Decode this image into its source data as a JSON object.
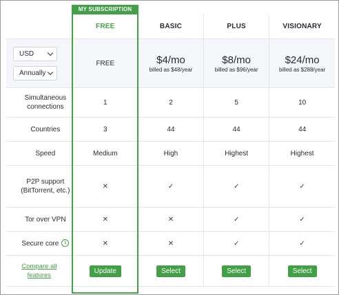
{
  "current_plan_tag": "MY SUBSCRIPTION",
  "plans": [
    {
      "name": "FREE",
      "price_main": "FREE",
      "price_billed": "",
      "button": "Update"
    },
    {
      "name": "BASIC",
      "price_main": "$4/mo",
      "price_billed": "billed as $48/year",
      "button": "Select"
    },
    {
      "name": "PLUS",
      "price_main": "$8/mo",
      "price_billed": "billed as $96/year",
      "button": "Select"
    },
    {
      "name": "VISIONARY",
      "price_main": "$24/mo",
      "price_billed": "billed as $288/year",
      "button": "Select"
    }
  ],
  "currency": {
    "selected": "USD"
  },
  "billing_cycle": {
    "selected": "Annually"
  },
  "features": {
    "simultaneous": {
      "label": "Simultaneous connections",
      "values": [
        "1",
        "2",
        "5",
        "10"
      ]
    },
    "countries": {
      "label": "Countries",
      "values": [
        "3",
        "44",
        "44",
        "44"
      ]
    },
    "speed": {
      "label": "Speed",
      "values": [
        "Medium",
        "High",
        "Highest",
        "Highest"
      ]
    },
    "p2p": {
      "label": "P2P support (BitTorrent, etc.)",
      "values": [
        "✕",
        "✓",
        "✓",
        "✓"
      ]
    },
    "tor": {
      "label": "Tor over VPN",
      "values": [
        "✕",
        "✕",
        "✓",
        "✓"
      ]
    },
    "secure_core": {
      "label": "Secure core",
      "values": [
        "✕",
        "✕",
        "✓",
        "✓"
      ]
    }
  },
  "compare_link": "Compare all features",
  "colors": {
    "accent": "#43a047",
    "border": "#e3e5ea",
    "price_row_bg": "#f5f6f9"
  },
  "icons": {
    "info": "info-circle-icon",
    "cross": "cross-icon",
    "check": "check-icon",
    "chevron": "chevron-down-icon"
  }
}
